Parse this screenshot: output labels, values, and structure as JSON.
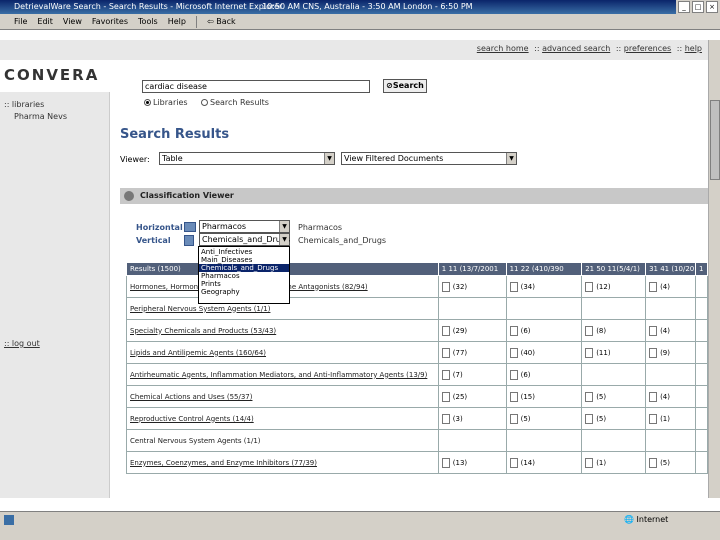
{
  "window": {
    "title": "DetrievalWare Search - Search Results - Microsoft Internet Explorer",
    "clock": "10:50 AM CNS, Australia - 3:50 AM London - 6:50 PM"
  },
  "menu": {
    "items": [
      "File",
      "Edit",
      "View",
      "Favorites",
      "Tools",
      "Help"
    ],
    "back_label": "Back"
  },
  "toplinks": [
    "search home",
    "advanced search",
    "preferences",
    "help"
  ],
  "logo": "CONVERA",
  "sidebar": {
    "libraries": ":: libraries",
    "pharma": "Pharma Nevs",
    "logout": ":: log out"
  },
  "search": {
    "query": "cardiac disease",
    "button": "Search",
    "radio_libraries": "Libraries",
    "radio_results": "Search Results"
  },
  "heading": "Search Results",
  "viewer": {
    "label": "Viewer:",
    "value": "Table",
    "filter_value": "View Filtered Documents"
  },
  "classification": {
    "title": "Classification Viewer",
    "horizontal_label": "Horizontal",
    "horizontal_value": "Pharmacos",
    "horizontal_display": "Pharmacos",
    "vertical_label": "Vertical",
    "vertical_value": "Chemicals_and_Drugs",
    "vertical_display": "Chemicals_and_Drugs",
    "dropdown_options": [
      "Anti_Infectives",
      "Main_Diseases",
      "Chemicals_and_Drugs",
      "Pharmacos",
      "Prints",
      "Geography"
    ],
    "dropdown_selected": "Chemicals_and_Drugs"
  },
  "table": {
    "headers": [
      "Results (1500)",
      "1 11 (13/7/2001",
      "11 22 (410/390",
      "21 50 11(5/4/1)",
      "31 41 (10/20",
      "1"
    ],
    "rows": [
      {
        "label": "Hormones, Hormone Substitutes, and Hormone Antagonists (82/94)",
        "cells": [
          "(32)",
          "(34)",
          "(12)",
          "(4)"
        ]
      },
      {
        "label": "Peripheral Nervous System Agents (1/1)",
        "cells": [
          "",
          "",
          "",
          ""
        ]
      },
      {
        "label": "Specialty Chemicals and Products (53/43)",
        "cells": [
          "(29)",
          "(6)",
          "(8)",
          "(4)"
        ]
      },
      {
        "label": "Lipids and Antilipemic Agents (160/64)",
        "cells": [
          "(77)",
          "(40)",
          "(11)",
          "(9)"
        ]
      },
      {
        "label": "Antirheumatic Agents, Inflammation Mediators, and Anti-Inflammatory Agents (13/9)",
        "cells": [
          "(7)",
          "(6)",
          "",
          ""
        ]
      },
      {
        "label": "Chemical Actions and Uses (55/37)",
        "cells": [
          "(25)",
          "(15)",
          "(5)",
          "(4)"
        ]
      },
      {
        "label": "Reproductive Control Agents (14/4)",
        "cells": [
          "(3)",
          "(5)",
          "(5)",
          "(1)"
        ]
      },
      {
        "label": "Central Nervous System Agents (1/1)",
        "cells": [
          "",
          "",
          "",
          ""
        ]
      },
      {
        "label": "Enzymes, Coenzymes, and Enzyme Inhibitors (77/39)",
        "cells": [
          "(13)",
          "(14)",
          "(1)",
          "(5)"
        ]
      }
    ]
  },
  "status": {
    "zone": "Internet"
  }
}
